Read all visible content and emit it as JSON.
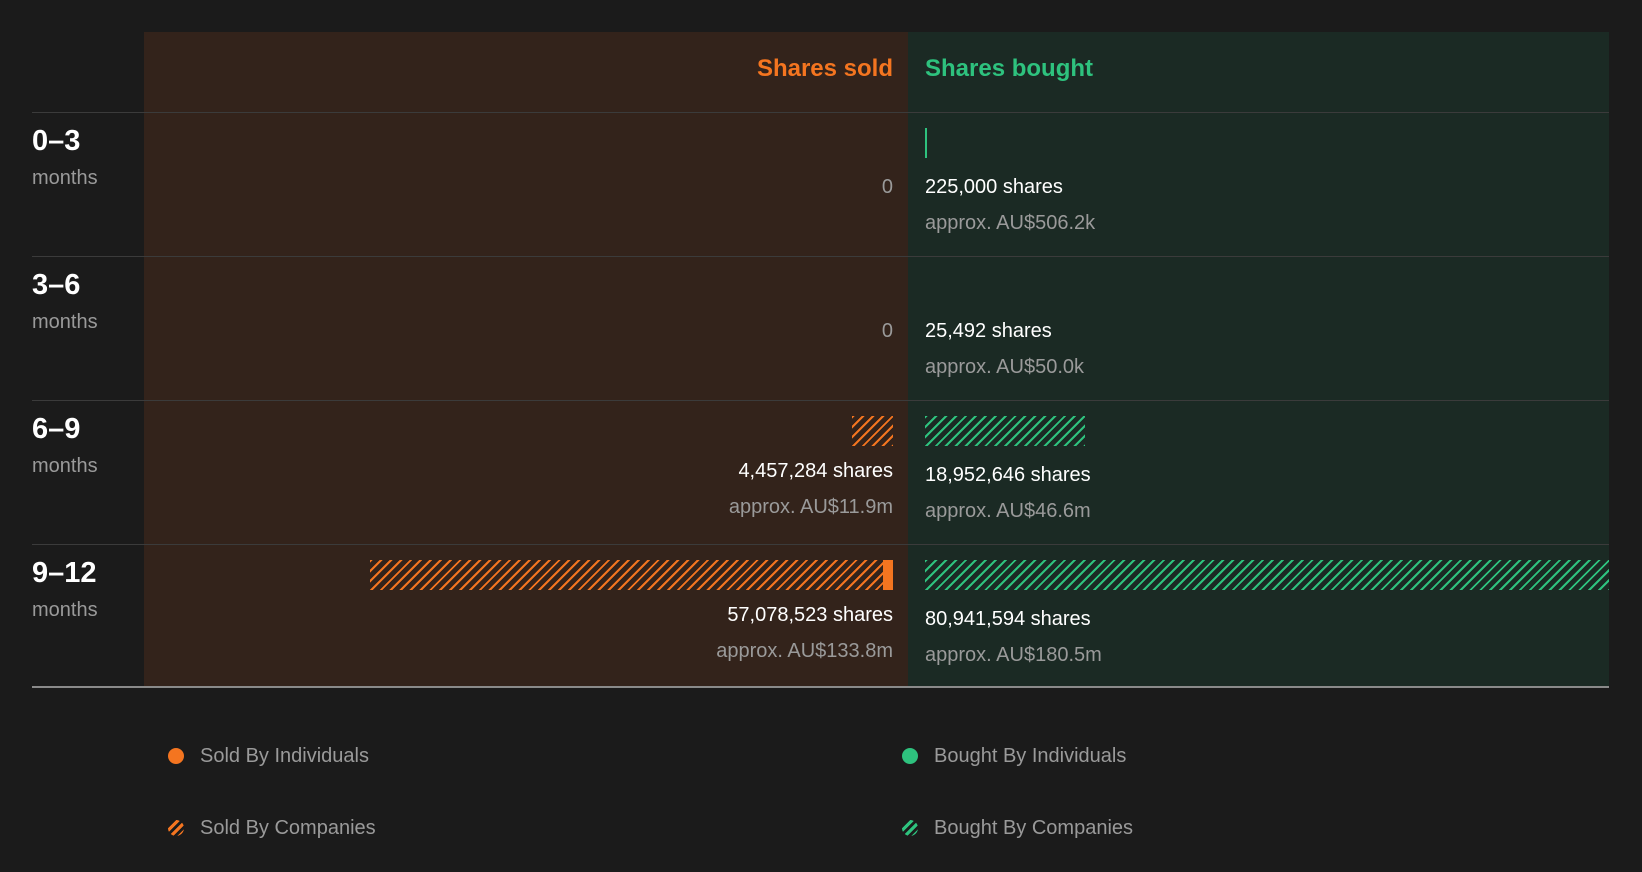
{
  "chart_data": {
    "type": "bar",
    "orientation": "horizontal-diverging",
    "headers": {
      "sold": "Shares sold",
      "bought": "Shares bought"
    },
    "unit_label": "months",
    "colors": {
      "sold": "#f47520",
      "bought": "#2ec27e"
    },
    "rows": [
      {
        "label": "0–3",
        "sold": {
          "shares": 0,
          "individuals": 0,
          "companies": 0,
          "shares_text": "0",
          "value_text": ""
        },
        "bought": {
          "shares": 225000,
          "individuals": 225000,
          "companies": 0,
          "shares_text": "225,000 shares",
          "value_text": "approx. AU$506.2k"
        }
      },
      {
        "label": "3–6",
        "sold": {
          "shares": 0,
          "individuals": 0,
          "companies": 0,
          "shares_text": "0",
          "value_text": ""
        },
        "bought": {
          "shares": 25492,
          "individuals": 25492,
          "companies": 0,
          "shares_text": "25,492 shares",
          "value_text": "approx. AU$50.0k"
        }
      },
      {
        "label": "6–9",
        "sold": {
          "shares": 4457284,
          "individuals": 0,
          "companies": 4457284,
          "shares_text": "4,457,284 shares",
          "value_text": "approx. AU$11.9m"
        },
        "bought": {
          "shares": 18952646,
          "individuals": 0,
          "companies": 18952646,
          "shares_text": "18,952,646 shares",
          "value_text": "approx. AU$46.6m"
        }
      },
      {
        "label": "9–12",
        "sold": {
          "shares": 57078523,
          "individuals": 1000000,
          "companies": 56078523,
          "shares_text": "57,078,523 shares",
          "value_text": "approx. AU$133.8m"
        },
        "bought": {
          "shares": 80941594,
          "individuals": 0,
          "companies": 80941594,
          "shares_text": "80,941,594 shares",
          "value_text": "approx. AU$180.5m"
        }
      }
    ],
    "legend": [
      {
        "key": "sold-ind",
        "label": "Sold By Individuals"
      },
      {
        "key": "bought-ind",
        "label": "Bought By Individuals"
      },
      {
        "key": "sold-co",
        "label": "Sold By Companies"
      },
      {
        "key": "bought-co",
        "label": "Bought By Companies"
      }
    ]
  }
}
